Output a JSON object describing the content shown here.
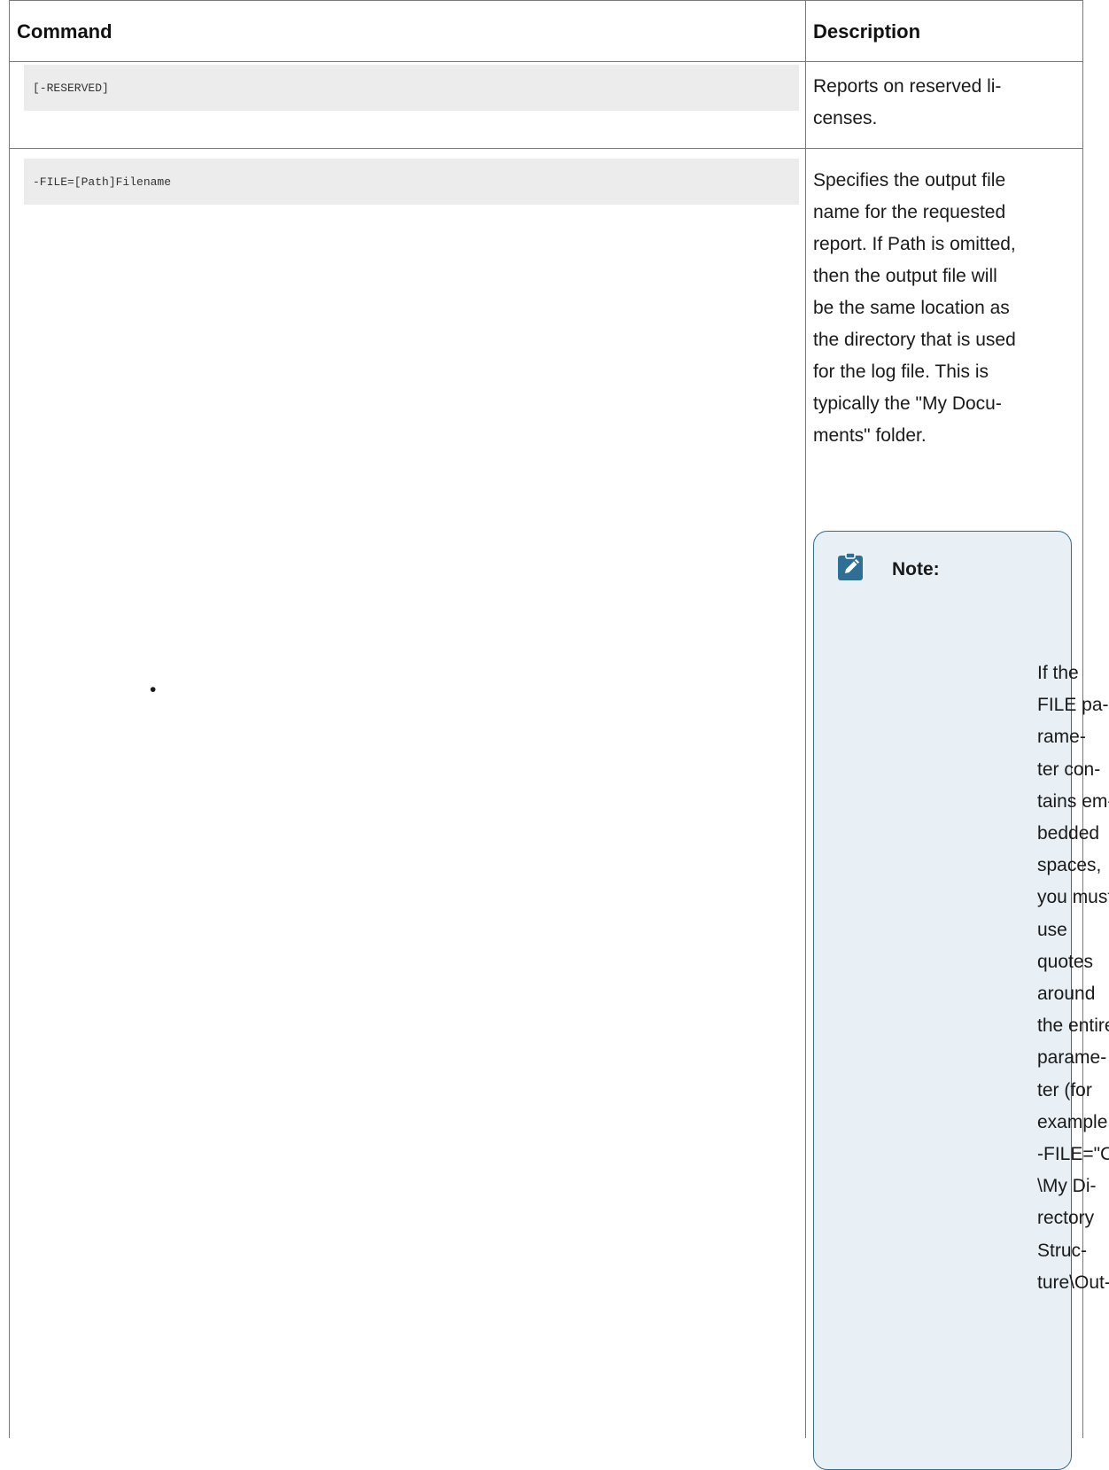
{
  "table": {
    "headers": {
      "command": "Command",
      "description": "Description"
    },
    "rows": [
      {
        "command": "[-RESERVED]",
        "description_lines": [
          "Reports on reserved li-",
          "censes."
        ]
      },
      {
        "command": "-FILE=[Path]Filename",
        "description_lines": [
          "Specifies the output file",
          "name for the requested",
          "report. If Path is omitted,",
          "then the output file will",
          "be the same location as",
          "the directory that is used",
          "for the log file. This is",
          "typically the \"My Docu-",
          "ments\" folder."
        ],
        "note": {
          "icon": "pencil-note-icon",
          "title": "Note:",
          "bullet": "•",
          "lines": [
            "If the",
            "FILE pa-",
            "rame-",
            "ter con-",
            "tains em-",
            "bedded",
            "spaces,",
            "you must",
            "use",
            "quotes",
            "around",
            "the entire",
            "parame-",
            "ter (for",
            "example,",
            "-FILE=\"C:",
            "\\My Di-",
            "rectory",
            "Struc-",
            "ture\\Out-"
          ]
        }
      }
    ]
  },
  "colors": {
    "note_accent": "#2f6f95",
    "note_background": "#e8f0f5",
    "code_background": "#ececec"
  }
}
